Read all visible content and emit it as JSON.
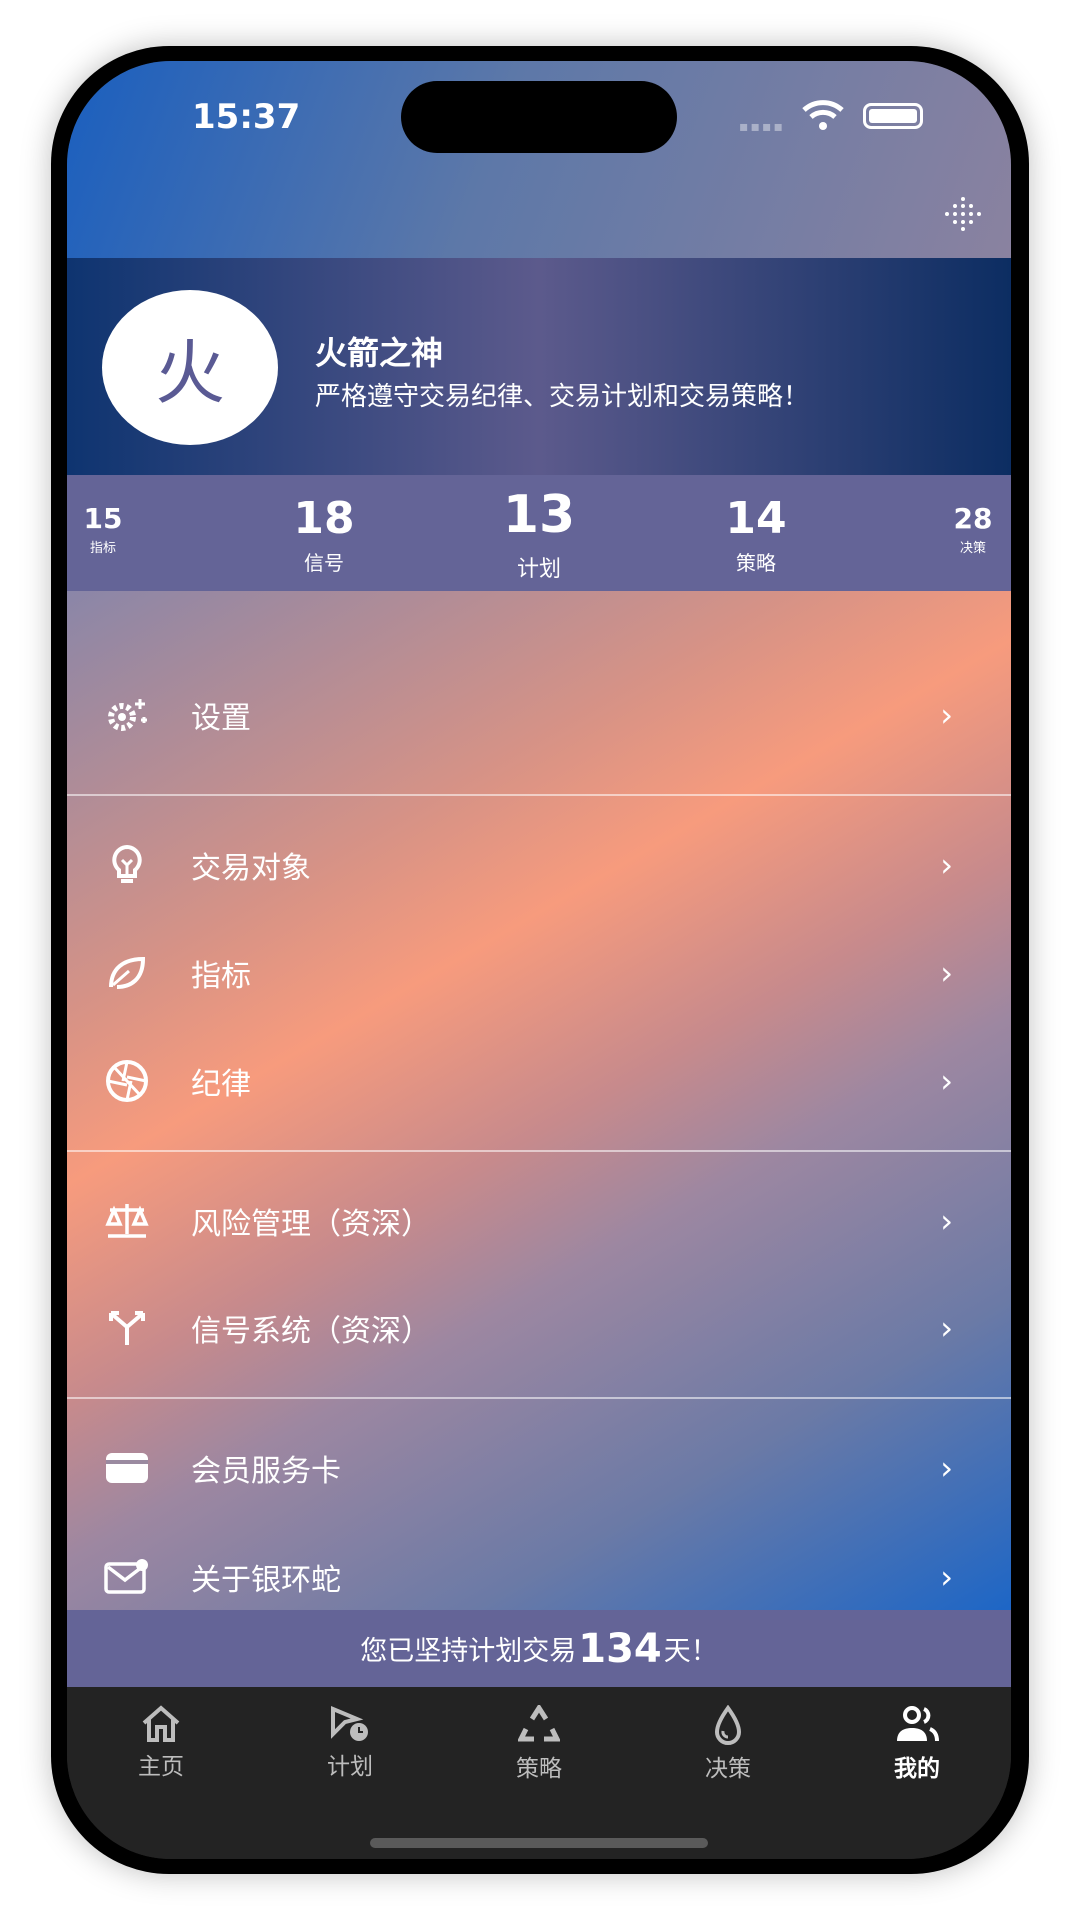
{
  "status_bar": {
    "time": "15:37"
  },
  "profile": {
    "avatar_char": "火",
    "name": "火箭之神",
    "motto": "严格遵守交易纪律、交易计划和交易策略！"
  },
  "stats": [
    {
      "value": "15",
      "label": "指标"
    },
    {
      "value": "18",
      "label": "信号"
    },
    {
      "value": "13",
      "label": "计划"
    },
    {
      "value": "14",
      "label": "策略"
    },
    {
      "value": "28",
      "label": "决策"
    }
  ],
  "menu": [
    {
      "label": "设置",
      "icon": "gears-icon"
    },
    {
      "label": "交易对象",
      "icon": "lightbulb-icon"
    },
    {
      "label": "指标",
      "icon": "leaf-icon"
    },
    {
      "label": "纪律",
      "icon": "aperture-icon"
    },
    {
      "label": "风险管理（资深）",
      "icon": "scale-icon"
    },
    {
      "label": "信号系统（资深）",
      "icon": "split-arrows-icon"
    },
    {
      "label": "会员服务卡",
      "icon": "card-icon"
    },
    {
      "label": "关于银环蛇",
      "icon": "mail-icon"
    }
  ],
  "banner": {
    "prefix": "您已坚持计划交易",
    "days": "134",
    "suffix": "天！"
  },
  "tabs": [
    {
      "label": "主页",
      "icon": "home-icon"
    },
    {
      "label": "计划",
      "icon": "plan-icon"
    },
    {
      "label": "策略",
      "icon": "recycle-icon"
    },
    {
      "label": "决策",
      "icon": "drop-icon"
    },
    {
      "label": "我的",
      "icon": "users-icon",
      "active": true
    }
  ],
  "colors": {
    "stats_bg": "#646497",
    "tabbar_bg": "#232323",
    "avatar_text": "#5a5a94"
  }
}
